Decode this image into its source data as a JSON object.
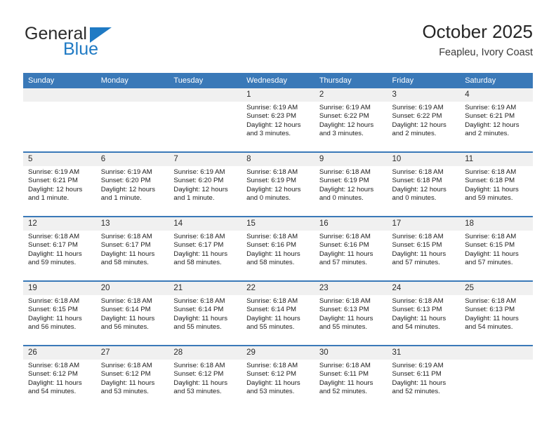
{
  "brand": {
    "word_general": "General",
    "word_blue": "Blue",
    "logo_color": "#1f7ac4",
    "triangle_icon": "triangle-icon"
  },
  "header": {
    "title": "October 2025",
    "subtitle": "Feapleu, Ivory Coast"
  },
  "theme": {
    "header_bg": "#3a79b8",
    "daynum_bg": "#f0f0f0",
    "text": "#1c1c1c"
  },
  "weekday_headers": [
    "Sunday",
    "Monday",
    "Tuesday",
    "Wednesday",
    "Thursday",
    "Friday",
    "Saturday"
  ],
  "labels": {
    "sunrise": "Sunrise:",
    "sunset": "Sunset:",
    "daylight": "Daylight:"
  },
  "weeks": [
    [
      {
        "day": "",
        "empty": true
      },
      {
        "day": "",
        "empty": true
      },
      {
        "day": "",
        "empty": true
      },
      {
        "day": "1",
        "sunrise": "Sunrise: 6:19 AM",
        "sunset": "Sunset: 6:23 PM",
        "daylight1": "Daylight: 12 hours",
        "daylight2": "and 3 minutes."
      },
      {
        "day": "2",
        "sunrise": "Sunrise: 6:19 AM",
        "sunset": "Sunset: 6:22 PM",
        "daylight1": "Daylight: 12 hours",
        "daylight2": "and 3 minutes."
      },
      {
        "day": "3",
        "sunrise": "Sunrise: 6:19 AM",
        "sunset": "Sunset: 6:22 PM",
        "daylight1": "Daylight: 12 hours",
        "daylight2": "and 2 minutes."
      },
      {
        "day": "4",
        "sunrise": "Sunrise: 6:19 AM",
        "sunset": "Sunset: 6:21 PM",
        "daylight1": "Daylight: 12 hours",
        "daylight2": "and 2 minutes."
      }
    ],
    [
      {
        "day": "5",
        "sunrise": "Sunrise: 6:19 AM",
        "sunset": "Sunset: 6:21 PM",
        "daylight1": "Daylight: 12 hours",
        "daylight2": "and 1 minute."
      },
      {
        "day": "6",
        "sunrise": "Sunrise: 6:19 AM",
        "sunset": "Sunset: 6:20 PM",
        "daylight1": "Daylight: 12 hours",
        "daylight2": "and 1 minute."
      },
      {
        "day": "7",
        "sunrise": "Sunrise: 6:19 AM",
        "sunset": "Sunset: 6:20 PM",
        "daylight1": "Daylight: 12 hours",
        "daylight2": "and 1 minute."
      },
      {
        "day": "8",
        "sunrise": "Sunrise: 6:18 AM",
        "sunset": "Sunset: 6:19 PM",
        "daylight1": "Daylight: 12 hours",
        "daylight2": "and 0 minutes."
      },
      {
        "day": "9",
        "sunrise": "Sunrise: 6:18 AM",
        "sunset": "Sunset: 6:19 PM",
        "daylight1": "Daylight: 12 hours",
        "daylight2": "and 0 minutes."
      },
      {
        "day": "10",
        "sunrise": "Sunrise: 6:18 AM",
        "sunset": "Sunset: 6:18 PM",
        "daylight1": "Daylight: 12 hours",
        "daylight2": "and 0 minutes."
      },
      {
        "day": "11",
        "sunrise": "Sunrise: 6:18 AM",
        "sunset": "Sunset: 6:18 PM",
        "daylight1": "Daylight: 11 hours",
        "daylight2": "and 59 minutes."
      }
    ],
    [
      {
        "day": "12",
        "sunrise": "Sunrise: 6:18 AM",
        "sunset": "Sunset: 6:17 PM",
        "daylight1": "Daylight: 11 hours",
        "daylight2": "and 59 minutes."
      },
      {
        "day": "13",
        "sunrise": "Sunrise: 6:18 AM",
        "sunset": "Sunset: 6:17 PM",
        "daylight1": "Daylight: 11 hours",
        "daylight2": "and 58 minutes."
      },
      {
        "day": "14",
        "sunrise": "Sunrise: 6:18 AM",
        "sunset": "Sunset: 6:17 PM",
        "daylight1": "Daylight: 11 hours",
        "daylight2": "and 58 minutes."
      },
      {
        "day": "15",
        "sunrise": "Sunrise: 6:18 AM",
        "sunset": "Sunset: 6:16 PM",
        "daylight1": "Daylight: 11 hours",
        "daylight2": "and 58 minutes."
      },
      {
        "day": "16",
        "sunrise": "Sunrise: 6:18 AM",
        "sunset": "Sunset: 6:16 PM",
        "daylight1": "Daylight: 11 hours",
        "daylight2": "and 57 minutes."
      },
      {
        "day": "17",
        "sunrise": "Sunrise: 6:18 AM",
        "sunset": "Sunset: 6:15 PM",
        "daylight1": "Daylight: 11 hours",
        "daylight2": "and 57 minutes."
      },
      {
        "day": "18",
        "sunrise": "Sunrise: 6:18 AM",
        "sunset": "Sunset: 6:15 PM",
        "daylight1": "Daylight: 11 hours",
        "daylight2": "and 57 minutes."
      }
    ],
    [
      {
        "day": "19",
        "sunrise": "Sunrise: 6:18 AM",
        "sunset": "Sunset: 6:15 PM",
        "daylight1": "Daylight: 11 hours",
        "daylight2": "and 56 minutes."
      },
      {
        "day": "20",
        "sunrise": "Sunrise: 6:18 AM",
        "sunset": "Sunset: 6:14 PM",
        "daylight1": "Daylight: 11 hours",
        "daylight2": "and 56 minutes."
      },
      {
        "day": "21",
        "sunrise": "Sunrise: 6:18 AM",
        "sunset": "Sunset: 6:14 PM",
        "daylight1": "Daylight: 11 hours",
        "daylight2": "and 55 minutes."
      },
      {
        "day": "22",
        "sunrise": "Sunrise: 6:18 AM",
        "sunset": "Sunset: 6:14 PM",
        "daylight1": "Daylight: 11 hours",
        "daylight2": "and 55 minutes."
      },
      {
        "day": "23",
        "sunrise": "Sunrise: 6:18 AM",
        "sunset": "Sunset: 6:13 PM",
        "daylight1": "Daylight: 11 hours",
        "daylight2": "and 55 minutes."
      },
      {
        "day": "24",
        "sunrise": "Sunrise: 6:18 AM",
        "sunset": "Sunset: 6:13 PM",
        "daylight1": "Daylight: 11 hours",
        "daylight2": "and 54 minutes."
      },
      {
        "day": "25",
        "sunrise": "Sunrise: 6:18 AM",
        "sunset": "Sunset: 6:13 PM",
        "daylight1": "Daylight: 11 hours",
        "daylight2": "and 54 minutes."
      }
    ],
    [
      {
        "day": "26",
        "sunrise": "Sunrise: 6:18 AM",
        "sunset": "Sunset: 6:12 PM",
        "daylight1": "Daylight: 11 hours",
        "daylight2": "and 54 minutes."
      },
      {
        "day": "27",
        "sunrise": "Sunrise: 6:18 AM",
        "sunset": "Sunset: 6:12 PM",
        "daylight1": "Daylight: 11 hours",
        "daylight2": "and 53 minutes."
      },
      {
        "day": "28",
        "sunrise": "Sunrise: 6:18 AM",
        "sunset": "Sunset: 6:12 PM",
        "daylight1": "Daylight: 11 hours",
        "daylight2": "and 53 minutes."
      },
      {
        "day": "29",
        "sunrise": "Sunrise: 6:18 AM",
        "sunset": "Sunset: 6:12 PM",
        "daylight1": "Daylight: 11 hours",
        "daylight2": "and 53 minutes."
      },
      {
        "day": "30",
        "sunrise": "Sunrise: 6:18 AM",
        "sunset": "Sunset: 6:11 PM",
        "daylight1": "Daylight: 11 hours",
        "daylight2": "and 52 minutes."
      },
      {
        "day": "31",
        "sunrise": "Sunrise: 6:19 AM",
        "sunset": "Sunset: 6:11 PM",
        "daylight1": "Daylight: 11 hours",
        "daylight2": "and 52 minutes."
      },
      {
        "day": "",
        "empty": true
      }
    ]
  ]
}
